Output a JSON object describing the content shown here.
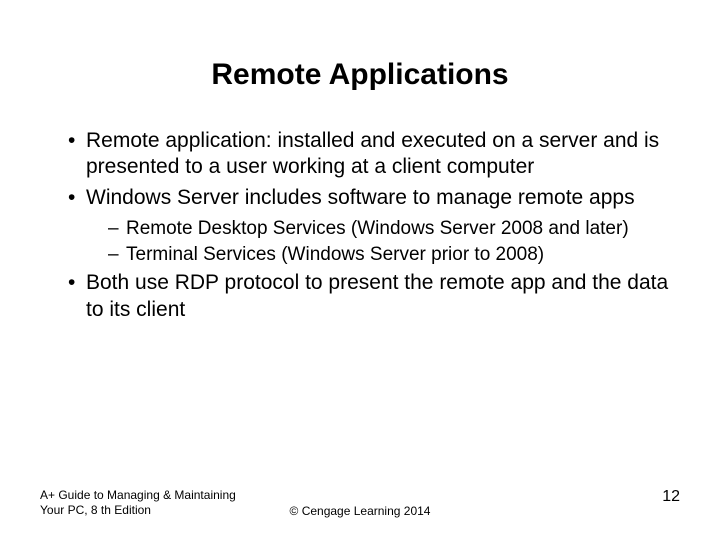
{
  "title": "Remote Applications",
  "bullets": {
    "b1": "Remote application: installed and executed on a server and is presented to a user working at a client computer",
    "b2": "Windows Server includes software to manage remote apps",
    "b2_sub": {
      "s1": "Remote Desktop Services (Windows Server 2008 and later)",
      "s2": "Terminal Services (Windows Server prior to 2008)"
    },
    "b3": "Both use RDP protocol to present the remote app and the data to its client"
  },
  "footer": {
    "left_line1": "A+ Guide to Managing & Maintaining",
    "left_line2": "Your PC, 8 th Edition",
    "center": "© Cengage Learning 2014",
    "page": "12"
  }
}
